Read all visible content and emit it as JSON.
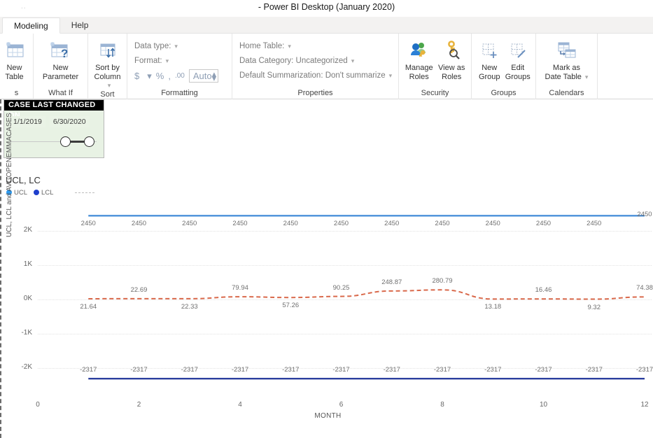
{
  "window": {
    "left_hint": "..",
    "title": "- Power BI Desktop (January 2020)"
  },
  "tabs": [
    {
      "label": "Modeling",
      "active": true
    },
    {
      "label": "Help",
      "active": false
    }
  ],
  "ribbon": {
    "groups": [
      {
        "name": "tables",
        "label": "s",
        "buttons": [
          {
            "icon": "new-table-icon",
            "line1": "New",
            "line2": "Table"
          }
        ]
      },
      {
        "name": "what-if",
        "label": "What If",
        "buttons": [
          {
            "icon": "new-parameter-icon",
            "line1": "New",
            "line2": "Parameter"
          }
        ]
      },
      {
        "name": "sort",
        "label": "Sort",
        "buttons": [
          {
            "icon": "sort-by-column-icon",
            "line1": "Sort by",
            "line2": "Column"
          }
        ]
      },
      {
        "name": "formatting",
        "label": "Formatting",
        "rows": [
          "Data type:",
          "Format:"
        ],
        "currency_symbol": "$",
        "percent_symbol": "%",
        "thousands_symbol": ",",
        "decimal_symbol": ".00",
        "auto_value": "Auto"
      },
      {
        "name": "properties",
        "label": "Properties",
        "rows": [
          "Home Table:",
          "Data Category: Uncategorized",
          "Default Summarization: Don't summarize"
        ]
      },
      {
        "name": "security",
        "label": "Security",
        "buttons": [
          {
            "icon": "manage-roles-icon",
            "line1": "Manage",
            "line2": "Roles"
          },
          {
            "icon": "view-as-roles-icon",
            "line1": "View as",
            "line2": "Roles"
          }
        ]
      },
      {
        "name": "groups",
        "label": "Groups",
        "buttons": [
          {
            "icon": "new-group-icon",
            "line1": "New",
            "line2": "Group"
          },
          {
            "icon": "edit-groups-icon",
            "line1": "Edit",
            "line2": "Groups"
          }
        ]
      },
      {
        "name": "calendars",
        "label": "Calendars",
        "buttons": [
          {
            "icon": "mark-as-date-table-icon",
            "line1": "Mark as",
            "line2": "Date Table"
          }
        ]
      }
    ]
  },
  "slicer": {
    "title": "CASE LAST CHANGED ON",
    "start_date": "1/1/2019",
    "end_date": "6/30/2020"
  },
  "chart_data": {
    "type": "line",
    "title": "UCL, LC",
    "xlabel": "MONTH",
    "ylabel": "UCL, LCL and AVGOPENEMMACASES",
    "xlim": [
      0,
      12
    ],
    "ylim": [
      -2600,
      2600
    ],
    "yticks": [
      "2K",
      "1K",
      "0K",
      "-1K",
      "-2K"
    ],
    "ytick_values": [
      2000,
      1000,
      0,
      -1000,
      -2000
    ],
    "xticks": [
      "0",
      "2",
      "4",
      "6",
      "8",
      "10",
      "12"
    ],
    "xtick_values": [
      0,
      2,
      4,
      6,
      8,
      10,
      12
    ],
    "grid": true,
    "legend_position": "top-left",
    "x": [
      1,
      2,
      3,
      4,
      5,
      6,
      7,
      8,
      9,
      10,
      11,
      12
    ],
    "series": [
      {
        "name": "UCL",
        "color": "#4a90d9",
        "style": "solid",
        "values": [
          2450,
          2450,
          2450,
          2450,
          2450,
          2450,
          2450,
          2450,
          2450,
          2450,
          2450,
          2450
        ],
        "labels": [
          "2450",
          "2450",
          "2450",
          "2450",
          "2450",
          "2450",
          "2450",
          "2450",
          "2450",
          "2450",
          "2450",
          "2450"
        ],
        "label_positions": [
          "below",
          "below",
          "below",
          "below",
          "below",
          "below",
          "below",
          "below",
          "below",
          "below",
          "below",
          "on"
        ]
      },
      {
        "name": "AVGOPENEMMACASES",
        "color": "#d9694b",
        "style": "dashed",
        "values": [
          21.64,
          22.69,
          22.33,
          79.94,
          57.26,
          90.25,
          248.87,
          280.79,
          13.18,
          16.46,
          9.32,
          74.38
        ],
        "labels": [
          "21.64",
          "22.69",
          "22.33",
          "79.94",
          "57.26",
          "90.25",
          "248.87",
          "280.79",
          "13.18",
          "16.46",
          "9.32",
          "74.38"
        ],
        "label_positions": [
          "below",
          "above",
          "below",
          "above",
          "below",
          "above",
          "above",
          "above",
          "below",
          "above",
          "below",
          "above"
        ]
      },
      {
        "name": "LCL",
        "color": "#2b3f9e",
        "style": "solid",
        "values": [
          -2317,
          -2317,
          -2317,
          -2317,
          -2317,
          -2317,
          -2317,
          -2317,
          -2317,
          -2317,
          -2317,
          -2317
        ],
        "labels": [
          "-2317",
          "-2317",
          "-2317",
          "-2317",
          "-2317",
          "-2317",
          "-2317",
          "-2317",
          "-2317",
          "-2317",
          "-2317",
          "-2317"
        ],
        "label_positions": [
          "above",
          "above",
          "above",
          "above",
          "above",
          "above",
          "above",
          "above",
          "above",
          "above",
          "above",
          "above"
        ]
      }
    ],
    "legend_entries": [
      {
        "label": "UCL",
        "color": "#2e9bf0",
        "marker": "dot"
      },
      {
        "label": "LCL",
        "color": "#1f3fcc",
        "marker": "dot"
      },
      {
        "label": "",
        "color": "#bdbdbd",
        "marker": "dash"
      }
    ]
  }
}
